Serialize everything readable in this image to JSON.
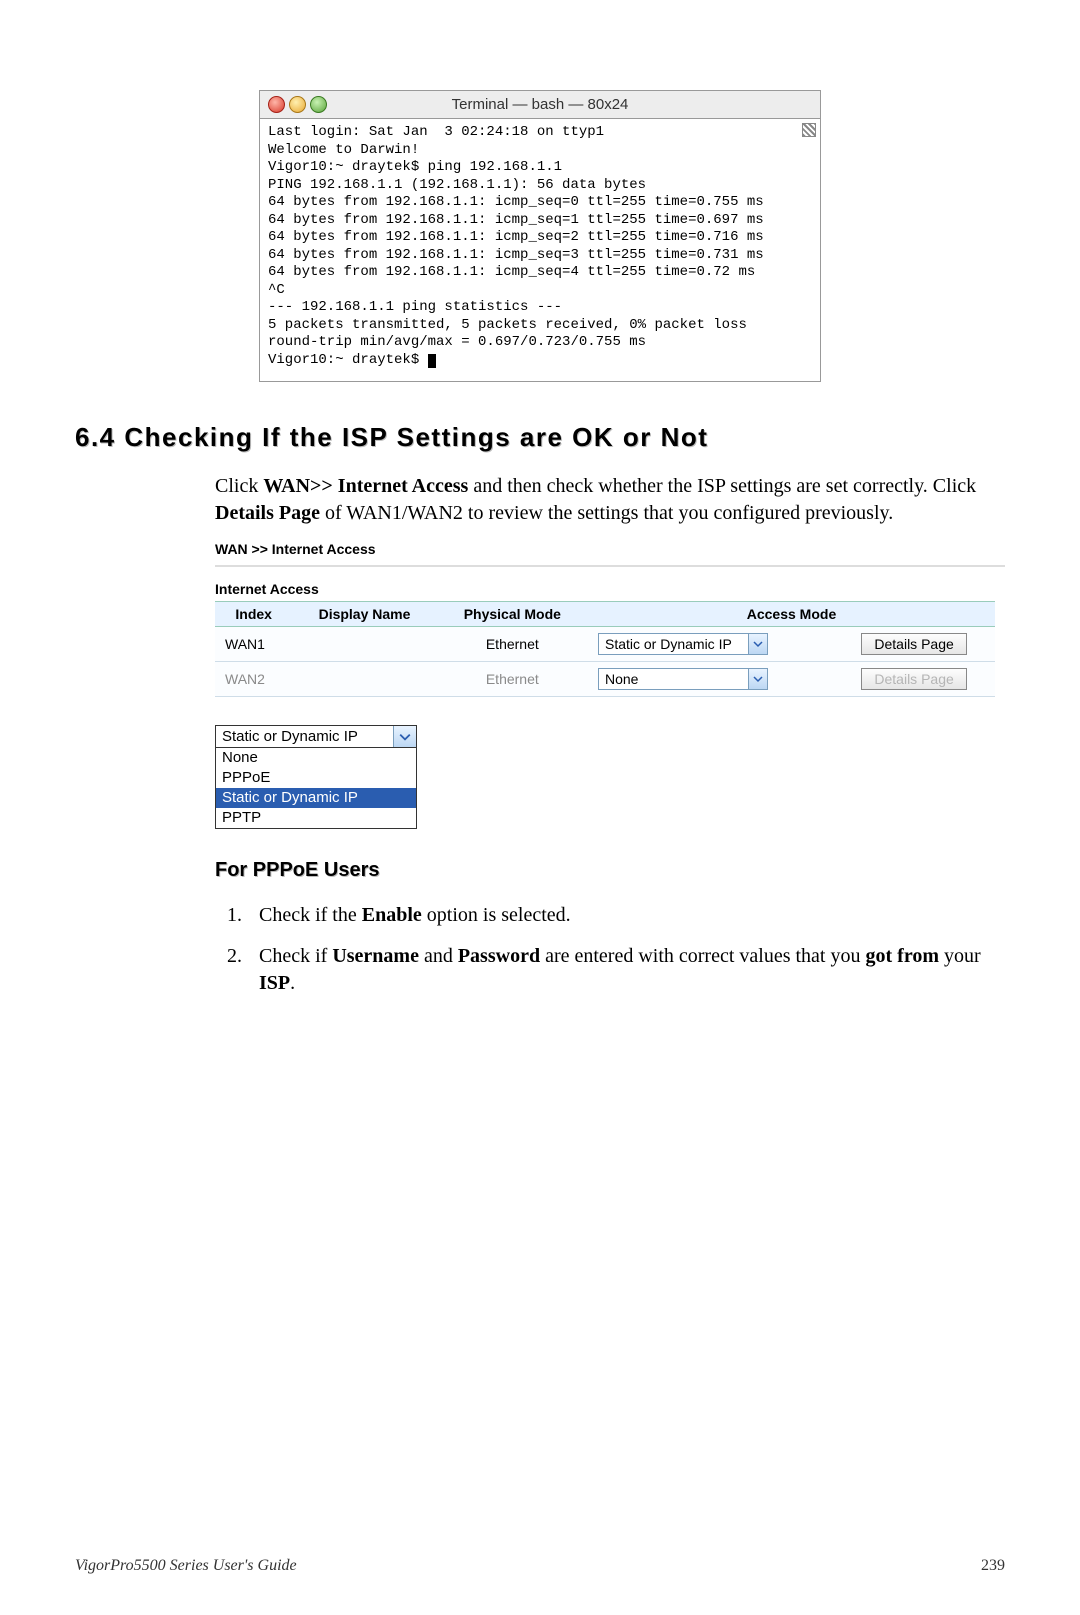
{
  "terminal": {
    "title": "Terminal — bash — 80x24",
    "lines": [
      "Last login: Sat Jan  3 02:24:18 on ttyp1",
      "Welcome to Darwin!",
      "Vigor10:~ draytek$ ping 192.168.1.1",
      "PING 192.168.1.1 (192.168.1.1): 56 data bytes",
      "64 bytes from 192.168.1.1: icmp_seq=0 ttl=255 time=0.755 ms",
      "64 bytes from 192.168.1.1: icmp_seq=1 ttl=255 time=0.697 ms",
      "64 bytes from 192.168.1.1: icmp_seq=2 ttl=255 time=0.716 ms",
      "64 bytes from 192.168.1.1: icmp_seq=3 ttl=255 time=0.731 ms",
      "64 bytes from 192.168.1.1: icmp_seq=4 ttl=255 time=0.72 ms",
      "^C",
      "--- 192.168.1.1 ping statistics ---",
      "5 packets transmitted, 5 packets received, 0% packet loss",
      "round-trip min/avg/max = 0.697/0.723/0.755 ms",
      "Vigor10:~ draytek$ "
    ]
  },
  "section_heading": "6.4 Checking If the ISP Settings are OK or Not",
  "intro": {
    "p1a": "Click ",
    "p1b": "WAN>> Internet Access",
    "p1c": " and then check whether the ISP settings are set correctly. Click ",
    "p1d": "Details Page",
    "p1e": " of WAN1/WAN2 to review the settings that you configured previously."
  },
  "breadcrumb": "WAN >> Internet Access",
  "panel_title": "Internet Access",
  "table": {
    "headers": [
      "Index",
      "Display Name",
      "Physical Mode",
      "Access Mode"
    ],
    "rows": [
      {
        "index": "WAN1",
        "display_name": "",
        "physical_mode": "Ethernet",
        "access_mode": "Static or Dynamic IP",
        "button": "Details Page",
        "enabled": true
      },
      {
        "index": "WAN2",
        "display_name": "",
        "physical_mode": "Ethernet",
        "access_mode": "None",
        "button": "Details Page",
        "enabled": false
      }
    ]
  },
  "dropdown": {
    "selected": "Static or Dynamic IP",
    "options": [
      "None",
      "PPPoE",
      "Static or Dynamic IP",
      "PPTP"
    ]
  },
  "sub_section": "For PPPoE Users",
  "steps": [
    {
      "pre": "Check if the ",
      "b1": "Enable",
      "post": " option is selected."
    },
    {
      "pre": "Check if ",
      "b1": "Username",
      "mid1": " and ",
      "b2": "Password",
      "mid2": " are entered with correct values that you ",
      "b3": "got from",
      "mid3": " your ",
      "b4": "ISP",
      "post": "."
    }
  ],
  "footer": {
    "guide": "VigorPro5500 Series User's Guide",
    "page": "239"
  }
}
